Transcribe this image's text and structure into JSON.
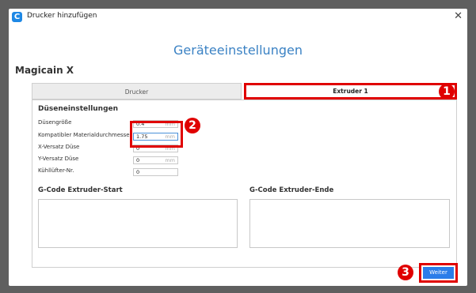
{
  "window": {
    "icon_letter": "C",
    "title": "Drucker hinzufügen",
    "close_glyph": "✕"
  },
  "heading": "Geräteeinstellungen",
  "machine_name": "Magicain X",
  "tabs": [
    {
      "label": "Drucker",
      "active": false
    },
    {
      "label": "Extruder 1",
      "active": true
    }
  ],
  "nozzle_settings": {
    "title": "Düseneinstellungen",
    "fields": [
      {
        "label": "Düsengröße",
        "value": "0.4",
        "unit": "mm"
      },
      {
        "label": "Kompatibler Materialdurchmesser",
        "value": "1.75",
        "unit": "mm"
      },
      {
        "label": "X-Versatz Düse",
        "value": "0",
        "unit": "mm"
      },
      {
        "label": "Y-Versatz Düse",
        "value": "0",
        "unit": "mm"
      },
      {
        "label": "Kühllüfter-Nr.",
        "value": "0",
        "unit": ""
      }
    ]
  },
  "gcode": {
    "start_label": "G-Code Extruder-Start",
    "end_label": "G-Code Extruder-Ende",
    "start_value": "",
    "end_value": ""
  },
  "next_button": "Weiter",
  "annotations": [
    "1",
    "2",
    "3"
  ],
  "colors": {
    "accent": "#3b82c4",
    "button": "#2b7de9",
    "annotation_red": "#e00000"
  }
}
